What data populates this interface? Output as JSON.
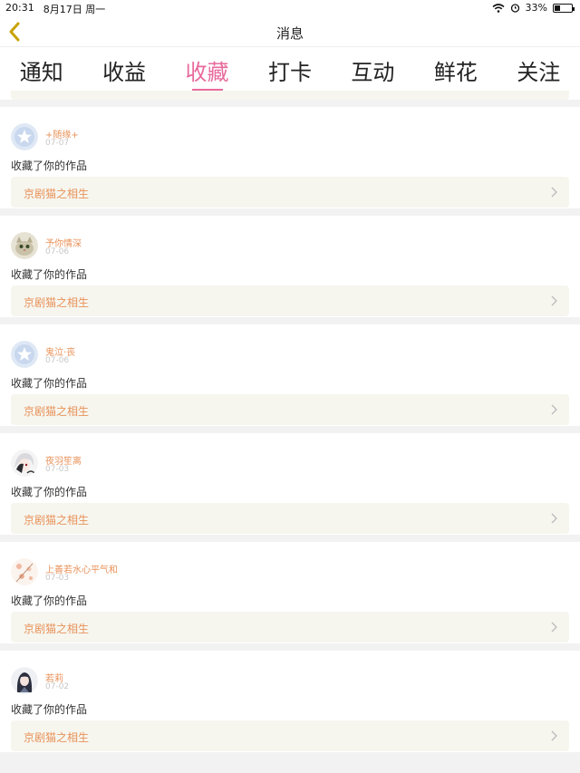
{
  "status": {
    "time": "20:31",
    "date": "8月17日 周一",
    "battery": "33%",
    "battery_level": 0.33
  },
  "nav": {
    "title": "消息"
  },
  "tabs": [
    {
      "label": "通知"
    },
    {
      "label": "收益"
    },
    {
      "label": "收藏",
      "active": true
    },
    {
      "label": "打卡"
    },
    {
      "label": "互动"
    },
    {
      "label": "鲜花"
    },
    {
      "label": "关注"
    }
  ],
  "items": [
    {
      "name": "+随缘+",
      "date": "07-07",
      "action": "收藏了你的作品",
      "work": "京剧猫之相生",
      "avatar": "star"
    },
    {
      "name": "予你情深",
      "date": "07-06",
      "action": "收藏了你的作品",
      "work": "京剧猫之相生",
      "avatar": "cat"
    },
    {
      "name": "鬼泣·丧",
      "date": "07-06",
      "action": "收藏了你的作品",
      "work": "京剧猫之相生",
      "avatar": "star"
    },
    {
      "name": "夜羽笙离",
      "date": "07-03",
      "action": "收藏了你的作品",
      "work": "京剧猫之相生",
      "avatar": "anime"
    },
    {
      "name": "上善若水心平气和",
      "date": "07-03",
      "action": "收藏了你的作品",
      "work": "京剧猫之相生",
      "avatar": "flower"
    },
    {
      "name": "若莉",
      "date": "07-02",
      "action": "收藏了你的作品",
      "work": "京剧猫之相生",
      "avatar": "girl"
    }
  ],
  "colors": {
    "accent": "#e86a9c",
    "link": "#e8925a",
    "back": "#c8a200"
  }
}
